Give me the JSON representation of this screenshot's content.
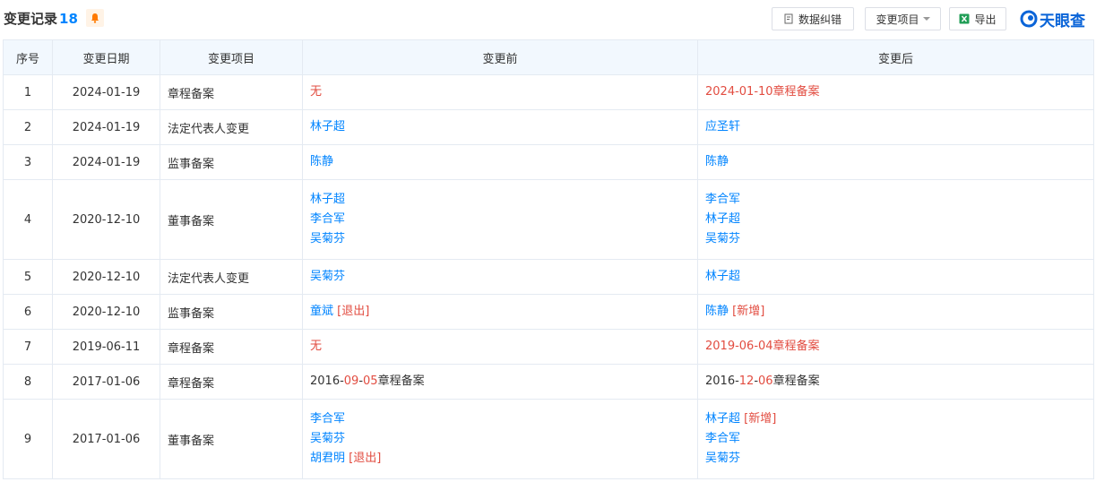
{
  "header": {
    "title": "变更记录",
    "count": "18",
    "buttons": {
      "report": "数据纠错",
      "filter": "变更项目",
      "export": "导出"
    },
    "logo": "天眼查"
  },
  "columns": [
    "序号",
    "变更日期",
    "变更项目",
    "变更前",
    "变更后"
  ],
  "rows": [
    {
      "no": "1",
      "date": "2024-01-19",
      "item": "章程备案",
      "before": [
        [
          {
            "t": "无",
            "c": "red"
          }
        ]
      ],
      "after": [
        [
          {
            "t": "2024-01-10章程备案",
            "c": "red"
          }
        ]
      ]
    },
    {
      "no": "2",
      "date": "2024-01-19",
      "item": "法定代表人变更",
      "before": [
        [
          {
            "t": "林子超",
            "c": "blue"
          }
        ]
      ],
      "after": [
        [
          {
            "t": "应圣轩",
            "c": "blue"
          }
        ]
      ]
    },
    {
      "no": "3",
      "date": "2024-01-19",
      "item": "监事备案",
      "before": [
        [
          {
            "t": "陈静",
            "c": "blue"
          }
        ]
      ],
      "after": [
        [
          {
            "t": "陈静",
            "c": "blue"
          }
        ]
      ]
    },
    {
      "no": "4",
      "date": "2020-12-10",
      "item": "董事备案",
      "before": [
        [
          {
            "t": "林子超",
            "c": "blue"
          }
        ],
        [
          {
            "t": "李合军",
            "c": "blue"
          }
        ],
        [
          {
            "t": "吴菊芬",
            "c": "blue"
          }
        ]
      ],
      "after": [
        [
          {
            "t": "李合军",
            "c": "blue"
          }
        ],
        [
          {
            "t": "林子超",
            "c": "blue"
          }
        ],
        [
          {
            "t": "吴菊芬",
            "c": "blue"
          }
        ]
      ]
    },
    {
      "no": "5",
      "date": "2020-12-10",
      "item": "法定代表人变更",
      "before": [
        [
          {
            "t": "吴菊芬",
            "c": "blue"
          }
        ]
      ],
      "after": [
        [
          {
            "t": "林子超",
            "c": "blue"
          }
        ]
      ]
    },
    {
      "no": "6",
      "date": "2020-12-10",
      "item": "监事备案",
      "before": [
        [
          {
            "t": "童斌",
            "c": "blue"
          },
          {
            "t": " [退出]",
            "c": "red"
          }
        ]
      ],
      "after": [
        [
          {
            "t": "陈静",
            "c": "blue"
          },
          {
            "t": " [新增]",
            "c": "red"
          }
        ]
      ]
    },
    {
      "no": "7",
      "date": "2019-06-11",
      "item": "章程备案",
      "before": [
        [
          {
            "t": "无",
            "c": "red"
          }
        ]
      ],
      "after": [
        [
          {
            "t": "2019-06-04章程备案",
            "c": "red"
          }
        ]
      ]
    },
    {
      "no": "8",
      "date": "2017-01-06",
      "item": "章程备案",
      "before": [
        [
          {
            "t": "2016-",
            "c": "black"
          },
          {
            "t": "09",
            "c": "red"
          },
          {
            "t": "-",
            "c": "black"
          },
          {
            "t": "05",
            "c": "red"
          },
          {
            "t": "章程备案",
            "c": "black"
          }
        ]
      ],
      "after": [
        [
          {
            "t": "2016-",
            "c": "black"
          },
          {
            "t": "12",
            "c": "red"
          },
          {
            "t": "-",
            "c": "black"
          },
          {
            "t": "06",
            "c": "red"
          },
          {
            "t": "章程备案",
            "c": "black"
          }
        ]
      ]
    },
    {
      "no": "9",
      "date": "2017-01-06",
      "item": "董事备案",
      "before": [
        [
          {
            "t": "李合军",
            "c": "blue"
          }
        ],
        [
          {
            "t": "吴菊芬",
            "c": "blue"
          }
        ],
        [
          {
            "t": "胡君明",
            "c": "blue"
          },
          {
            "t": " [退出]",
            "c": "red"
          }
        ]
      ],
      "after": [
        [
          {
            "t": "林子超",
            "c": "blue"
          },
          {
            "t": " [新增]",
            "c": "red"
          }
        ],
        [
          {
            "t": "李合军",
            "c": "blue"
          }
        ],
        [
          {
            "t": "吴菊芬",
            "c": "blue"
          }
        ]
      ]
    }
  ]
}
